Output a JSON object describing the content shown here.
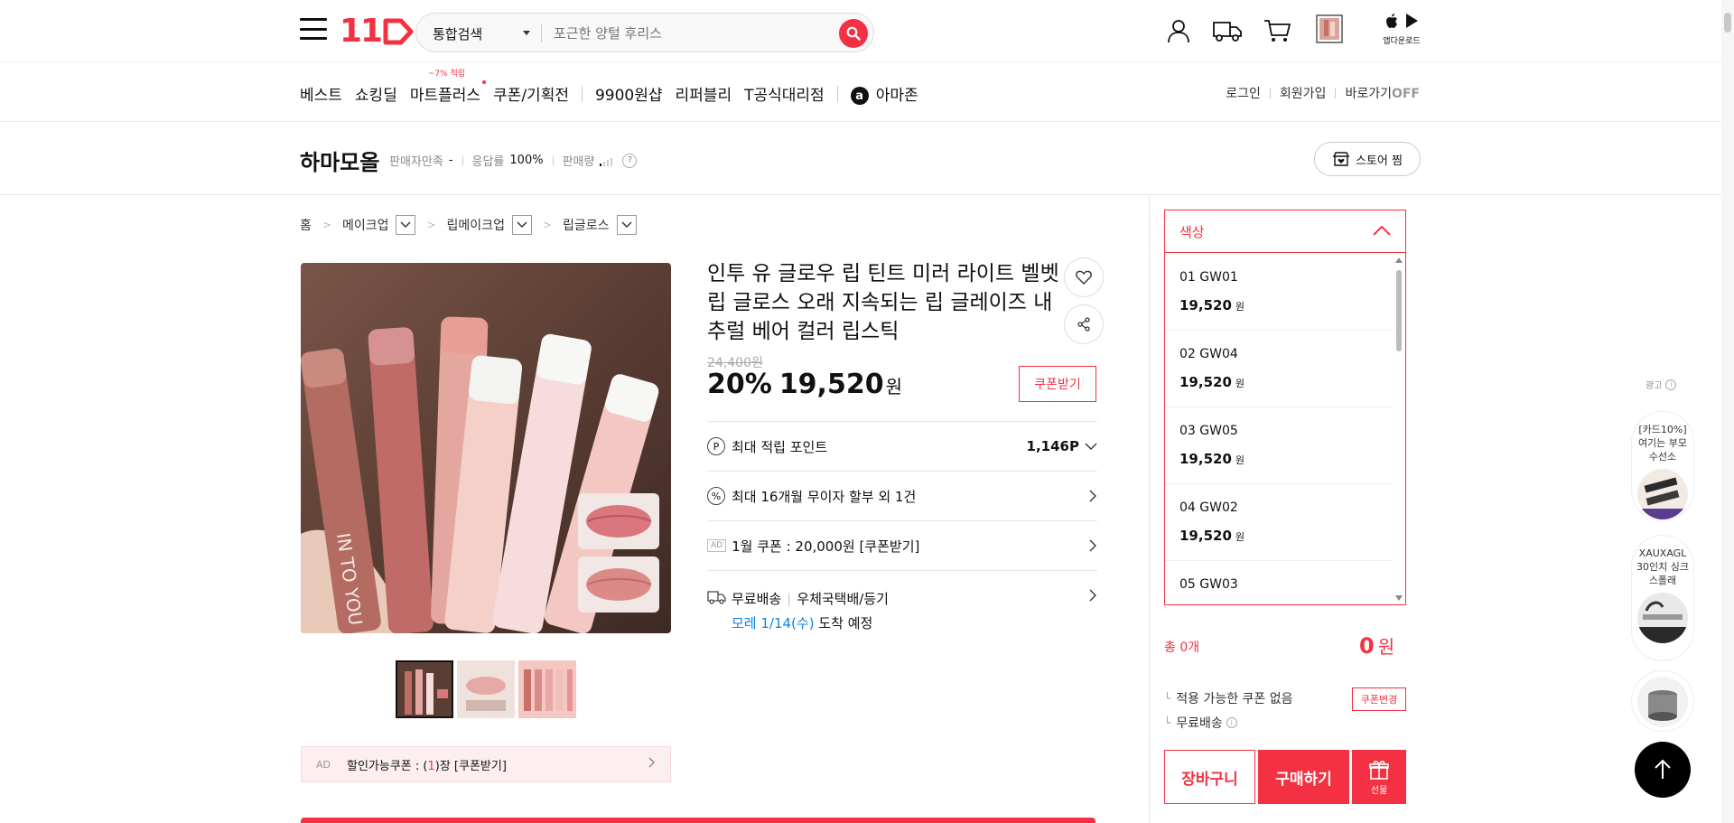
{
  "header": {
    "logo_text": "11",
    "search": {
      "category": "통합검색",
      "placeholder": "포근한 양털 후리스"
    },
    "app_download": "앱다운로드"
  },
  "nav": {
    "items": [
      "베스트",
      "쇼킹딜",
      "마트플러스",
      "쿠폰/기획전",
      "9900원샵",
      "리퍼블리",
      "T공식대리점",
      "아마존"
    ],
    "mart_badge": "~7% 적립",
    "amazon_letter": "a",
    "right": {
      "login": "로그인",
      "signup": "회원가입",
      "shortcut": "바로가기",
      "shortcut_state": "OFF"
    }
  },
  "seller": {
    "name": "하마모올",
    "satisfaction_label": "판매자만족",
    "satisfaction_value": "-",
    "response_label": "응답률",
    "response_value": "100%",
    "sales_label": "판매량",
    "help": "?",
    "store_button": "스토어 찜"
  },
  "breadcrumb": [
    "홈",
    "메이크업",
    "립메이크업",
    "립글로스"
  ],
  "product": {
    "title": "인투 유 글로우 립 틴트 미러 라이트 벨벳 립 글로스 오래 지속되는 립 글레이즈 내추럴 베어 컬러 립스틱",
    "original_price": "24,400원",
    "discount": "20%",
    "price": "19,520",
    "price_unit": "원",
    "coupon_button": "쿠폰받기",
    "points_label": "최대 적립 포인트",
    "points_value": "1,146P",
    "installment": "최대 16개월 무이자 할부 외 1건",
    "ad_tag": "AD",
    "coupon_row": "1월 쿠폰 : 20,000원 [쿠폰받기]",
    "shipping_free": "무료배송",
    "shipping_method": "우체국택배/등기",
    "arrival_date": "모레 1/14(수)",
    "arrival_suffix": "도착 예정",
    "image_text": "IN TO YOU"
  },
  "coupon_bar": {
    "ad": "AD",
    "prefix": "할인가능쿠폰 : (",
    "count": "1",
    "suffix": ")장 [쿠폰받기]"
  },
  "options": {
    "header": "색상",
    "items": [
      {
        "name": "01 GW01",
        "price": "19,520",
        "unit": "원"
      },
      {
        "name": "02 GW04",
        "price": "19,520",
        "unit": "원"
      },
      {
        "name": "03 GW05",
        "price": "19,520",
        "unit": "원"
      },
      {
        "name": "04 GW02",
        "price": "19,520",
        "unit": "원"
      },
      {
        "name": "05 GW03",
        "price": "",
        "unit": ""
      }
    ]
  },
  "order": {
    "total_label": "총 0개",
    "total_amount": "0",
    "total_unit": "원",
    "coupon_status": "적용 가능한 쿠폰 없음",
    "coupon_change": "쿠폰변경",
    "shipping": "무료배송",
    "cart_button": "장바구니",
    "buy_button": "구매하기",
    "gift_button": "선물"
  },
  "right_rail": {
    "ad_label": "광고",
    "ads": [
      {
        "text": "[카드10%] 여기는 부모 수선소"
      },
      {
        "text": "XAUXAGL 30인치 싱크 스폴래"
      },
      {
        "text": ""
      }
    ]
  },
  "colors": {
    "accent": "#f43142",
    "link_blue": "#0b83e6"
  },
  "icons": [
    "hamburger-icon",
    "search-icon",
    "user-icon",
    "truck-icon",
    "cart-icon",
    "recent-view-icon",
    "apple-icon",
    "play-store-icon",
    "heart-icon",
    "share-icon",
    "points-icon",
    "percent-icon",
    "delivery-icon",
    "chevron-down-icon",
    "chevron-right-icon",
    "chevron-up-icon",
    "store-icon",
    "gift-icon",
    "arrow-up-icon"
  ]
}
